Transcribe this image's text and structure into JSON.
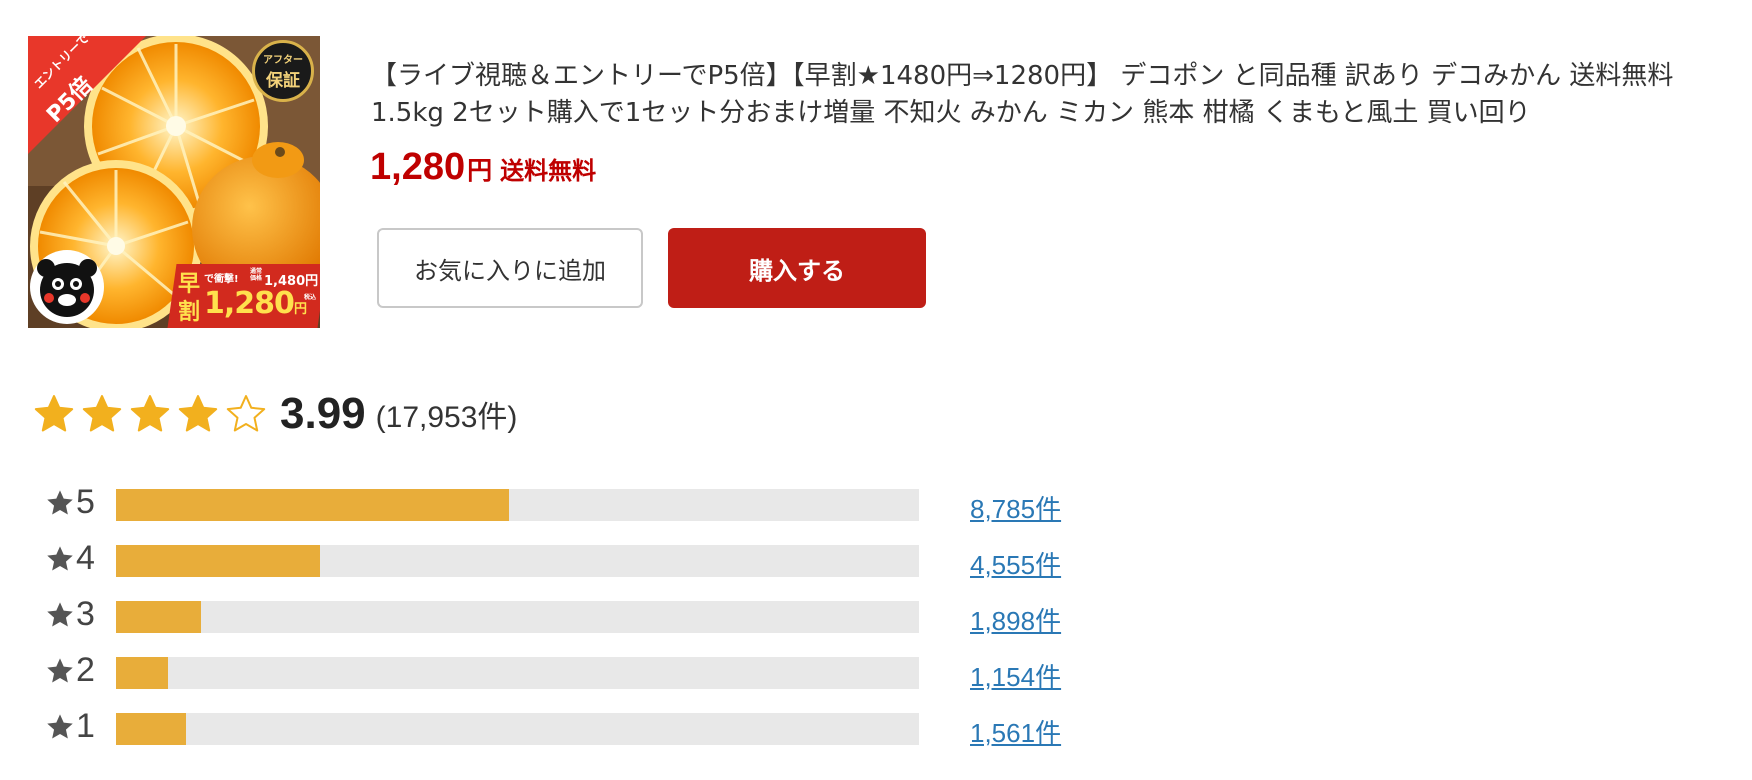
{
  "product": {
    "title": "【ライブ視聴＆エントリーでP5倍】【早割★1480円⇒1280円】 デコポン と同品種 訳あり デコみかん 送料無料 1.5kg 2セット購入で1セット分おまけ増量 不知火 みかん ミカン 熊本 柑橘 くまもと風土 買い回り",
    "price_value": "1,280",
    "price_unit": "円",
    "shipping": "送料無料",
    "image": {
      "badge_entry": "エントリーで",
      "badge_p5": "P5倍",
      "badge_after_small": "アフター",
      "badge_after_big": "保証",
      "promo_haya": "早",
      "promo_wari": "割",
      "promo_shogeki": "で衝撃!",
      "promo_old_label": "通常価格",
      "promo_old_price": "1,480円",
      "promo_new_price": "1,280",
      "promo_yen": "円",
      "promo_tax": "税込"
    }
  },
  "buttons": {
    "favorite_label": "お気に入りに追加",
    "buy_label": "購入する"
  },
  "rating": {
    "value": 3.99,
    "value_text": "3.99",
    "count_text": "(17,953件)",
    "distribution": [
      {
        "stars": "5",
        "count": 8785,
        "count_text": "8,785件"
      },
      {
        "stars": "4",
        "count": 4555,
        "count_text": "4,555件"
      },
      {
        "stars": "3",
        "count": 1898,
        "count_text": "1,898件"
      },
      {
        "stars": "2",
        "count": 1154,
        "count_text": "1,154件"
      },
      {
        "stars": "1",
        "count": 1561,
        "count_text": "1,561件"
      }
    ]
  },
  "colors": {
    "price_red": "#bf0000",
    "buy_button": "#bf1e16",
    "star_gold": "#f2b01e",
    "bar_fill": "#e8ad3a",
    "bar_track": "#e8e8e8",
    "link_blue": "#2a78b5"
  },
  "icons": [
    "star-full-icon",
    "star-half-icon",
    "star-empty-icon",
    "star-mini-icon"
  ]
}
